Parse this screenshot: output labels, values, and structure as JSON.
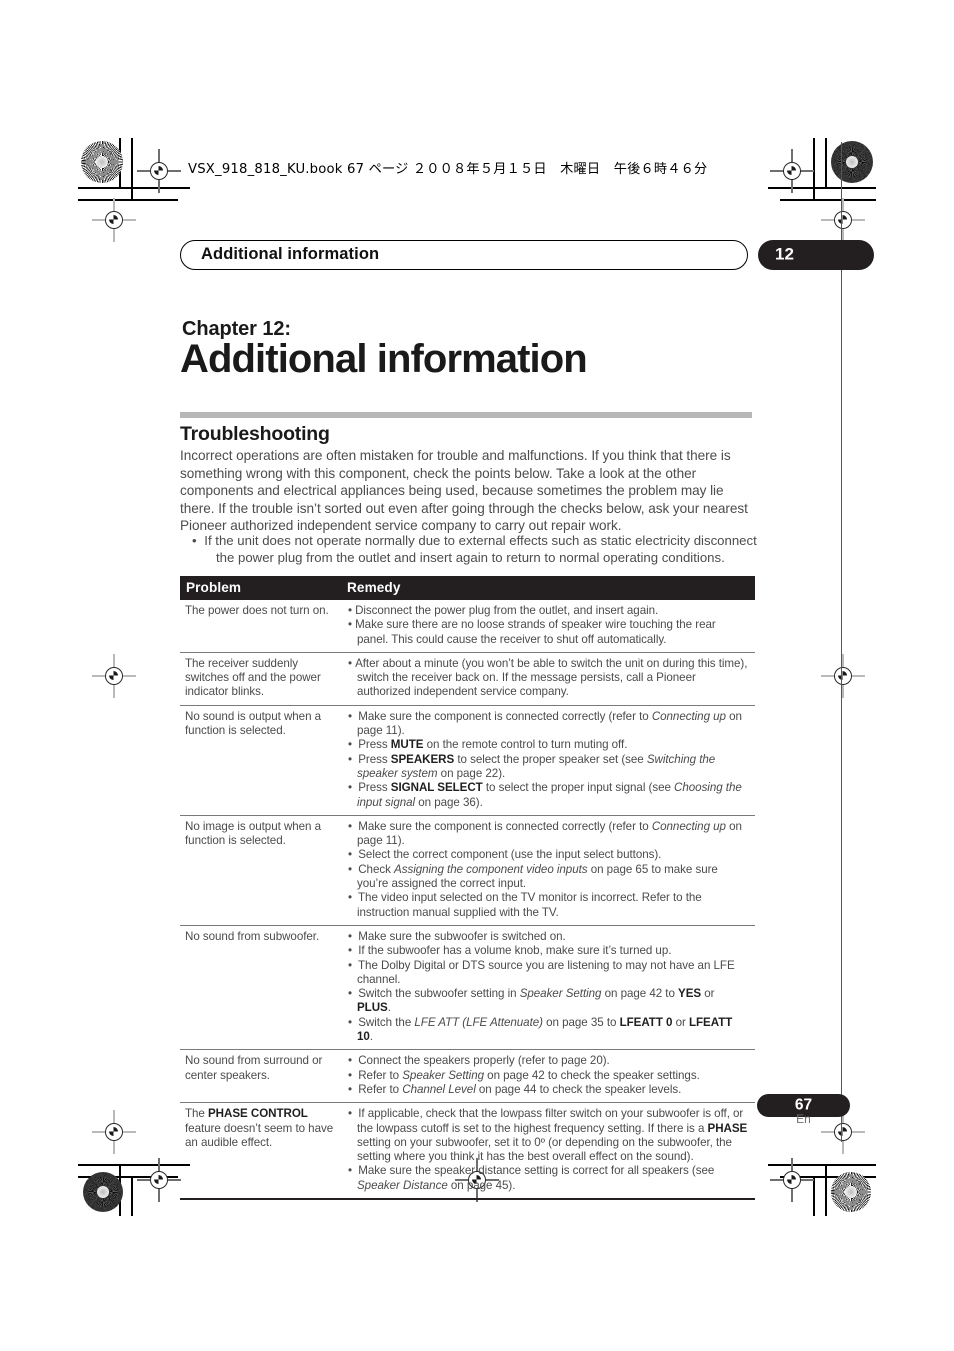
{
  "print_header": {
    "file_line": "VSX_918_818_KU.book  67 ページ  ２００８年５月１５日　木曜日　午後６時４６分"
  },
  "running_head": {
    "title": "Additional information",
    "chapter_number": "12"
  },
  "chapter": {
    "label": "Chapter 12:",
    "title": "Additional information"
  },
  "section": {
    "title": "Troubleshooting",
    "intro": "Incorrect operations are often mistaken for trouble and malfunctions. If you think that there is something wrong with this component, check the points below. Take a look at the other components and electrical appliances being used, because sometimes the problem may lie there. If the trouble isn’t sorted out even after going through the checks below, ask your nearest Pioneer authorized independent service company to carry out repair work.",
    "bullet_1_line_1": "If the unit does not operate normally due to external effects such as static electricity disconnect",
    "bullet_1_line_2": "the power plug from the outlet and insert again to return to normal operating conditions."
  },
  "table": {
    "headers": {
      "problem": "Problem",
      "remedy": "Remedy"
    },
    "rows": [
      {
        "problem": "The power does not turn on.",
        "remedies": [
          "Disconnect the power plug from the outlet, and insert again.",
          "Make sure there are no loose strands of speaker wire touching the rear panel. This could cause the receiver to shut off automatically."
        ]
      },
      {
        "problem": "The receiver suddenly switches off and the power indicator blinks.",
        "remedies": [
          "After about a minute (you won’t be able to switch the unit on during this time), switch the receiver back on. If the message persists, call a Pioneer authorized independent service company."
        ]
      },
      {
        "problem": "No sound is output when a function is selected.",
        "remedies": [
          "Make sure the component is connected correctly (refer to Connecting up on page 11).",
          "Press MUTE on the remote control to turn muting off.",
          "Press SPEAKERS to select the proper speaker set (see Switching the speaker system on page 22).",
          "Press SIGNAL SELECT to select the proper input signal (see Choosing the input signal on page 36)."
        ]
      },
      {
        "problem": "No image is output when a function is selected.",
        "remedies": [
          "Make sure the component is connected correctly (refer to Connecting up on page 11).",
          "Select the correct component (use the input select buttons).",
          "Check Assigning the component video inputs on page 65 to make sure you’re assigned the correct input.",
          "The video input selected on the TV monitor is incorrect. Refer to the instruction manual supplied with the TV."
        ]
      },
      {
        "problem": "No sound from subwoofer.",
        "remedies": [
          "Make sure the subwoofer is switched on.",
          "If the subwoofer has a volume knob, make sure it’s turned up.",
          "The Dolby Digital or DTS source you are listening to may not have an LFE channel.",
          "Switch the subwoofer setting in Speaker Setting on page 42 to YES or PLUS.",
          "Switch the LFE ATT (LFE Attenuate) on page 35 to LFEATT 0 or LFEATT 10."
        ]
      },
      {
        "problem": "No sound from surround or center speakers.",
        "remedies": [
          "Connect the speakers properly (refer to page 20).",
          "Refer to Speaker Setting on page 42 to check the speaker settings.",
          "Refer to Channel Level on page 44 to check the speaker levels."
        ]
      },
      {
        "problem": "The PHASE CONTROL feature doesn’t seem to have an audible effect.",
        "remedies": [
          "If applicable, check that the lowpass filter switch on your subwoofer is off, or the lowpass cutoff is set to the highest frequency setting. If there is a PHASE setting on your subwoofer, set it to 0º (or depending on the subwoofer, the setting where you think it has the best overall effect on the sound).",
          "Make sure the speaker distance setting is correct for all speakers (see Speaker Distance on page 45)."
        ]
      }
    ]
  },
  "footer": {
    "page_number": "67",
    "language": "En"
  },
  "colors": {
    "ink_black": "#231f20",
    "body_gray": "#4b4b4b",
    "rule_gray": "#b7b7b7"
  }
}
